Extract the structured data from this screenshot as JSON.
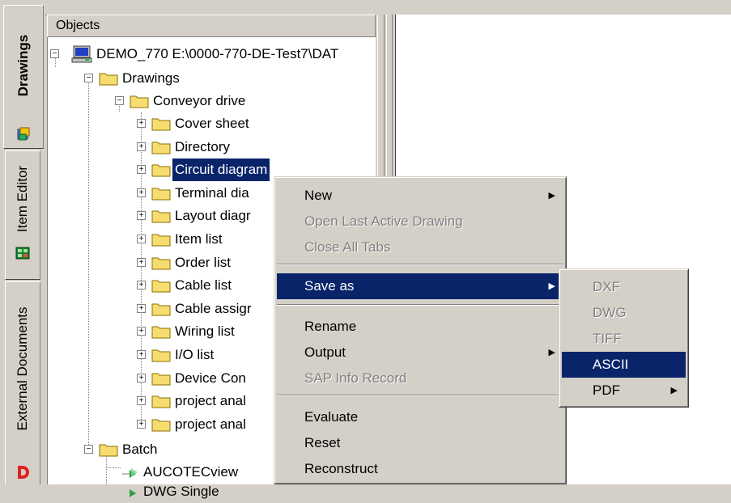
{
  "tabs": [
    {
      "label": "Drawings",
      "icon": "drawings-icon",
      "active": true
    },
    {
      "label": "Item Editor",
      "icon": "item-editor-icon",
      "active": false
    },
    {
      "label": "External Documents",
      "icon": "aucotec-logo-icon",
      "active": false
    }
  ],
  "tree": {
    "header": "Objects",
    "root": "DEMO_770 E:\\0000-770-DE-Test7\\DAT",
    "drawings": "Drawings",
    "conveyor": "Conveyor drive",
    "items": [
      "Cover sheet",
      "Directory",
      "Circuit diagram",
      "Terminal dia",
      "Layout diagr",
      "Item list",
      "Order list",
      "Cable list",
      "Cable assigr",
      "Wiring list",
      "I/O list",
      "Device Con",
      "project anal",
      "project anal"
    ],
    "batch": "Batch",
    "batch_items": [
      "AUCOTECview",
      "DWG Single"
    ]
  },
  "context_menu": {
    "items": [
      {
        "label": "New",
        "disabled": false,
        "submenu": true
      },
      {
        "label": "Open Last Active Drawing",
        "disabled": true,
        "submenu": false
      },
      {
        "label": "Close All Tabs",
        "disabled": true,
        "submenu": false
      },
      {
        "label": "Save as",
        "disabled": false,
        "submenu": true,
        "highlighted": true
      },
      {
        "label": "Rename",
        "disabled": false,
        "submenu": false
      },
      {
        "label": "Output",
        "disabled": false,
        "submenu": true
      },
      {
        "label": "SAP Info Record",
        "disabled": true,
        "submenu": false
      },
      {
        "label": "Evaluate",
        "disabled": false,
        "submenu": false
      },
      {
        "label": "Reset",
        "disabled": false,
        "submenu": false
      },
      {
        "label": "Reconstruct",
        "disabled": false,
        "submenu": false
      }
    ]
  },
  "save_as_submenu": {
    "items": [
      {
        "label": "DXF",
        "disabled": true
      },
      {
        "label": "DWG",
        "disabled": true
      },
      {
        "label": "TIFF",
        "disabled": true
      },
      {
        "label": "ASCII",
        "disabled": false,
        "highlighted": true
      },
      {
        "label": "PDF",
        "disabled": false,
        "submenu": true
      }
    ]
  },
  "colors": {
    "selection": "#0a246a",
    "face": "#d4d0c8",
    "folder": "#f7dc6f"
  }
}
